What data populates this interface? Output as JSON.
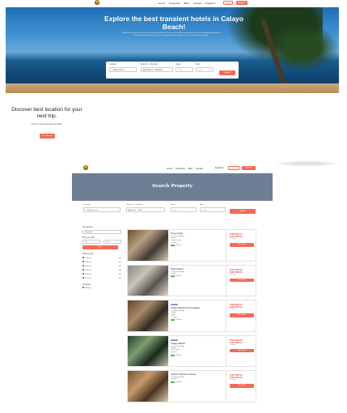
{
  "navbar": {
    "links": [
      "Home",
      "Properties",
      "Blog",
      "Contact"
    ],
    "language": "English",
    "login": "Login",
    "register": "Register"
  },
  "hero": {
    "title": "Explore the best transient hotels in Calayo Beach!",
    "subtitle": "Welcome to Guest, where your seaside escape begins! Discover your dream transient retreat with our handpicked collection of stunning beachside houses, all just a heartbeat away from the sun, sand, and waves adventure.",
    "search": {
      "location_label": "Location",
      "location_value": "Select One",
      "dates_label": "Check-In - Checkout",
      "dates_value": "Check-In - Checkout",
      "guests_label": "Guest",
      "guests_value": "1",
      "beds_label": "Beds",
      "beds_value": "1",
      "button": "Search"
    }
  },
  "discover": {
    "title": "Discover best location for your next trip.",
    "subtitle": "Find your perfect getaway destination",
    "button": "View all rooms"
  },
  "inner": {
    "navbar": {
      "links": [
        "Home",
        "Properties",
        "Blog",
        "Contact"
      ],
      "language": "English",
      "login": "Login",
      "register": "Register"
    },
    "banner_title": "Search Property",
    "search": {
      "location_label": "Location",
      "location_value": "Select One",
      "dates_label": "Check-In - Checkout",
      "dates_value": "1/1/23 - 1/2/23",
      "guests_label": "Guest",
      "guests_value": "1",
      "beds_label": "Bed",
      "beds_value": "1",
      "button": "Search"
    },
    "filters": {
      "sort_label": "Sort Results",
      "sort_value": "Popular",
      "price_label": "Price per night",
      "price_min": "Min",
      "price_max": "Max",
      "filter_button": "Filter",
      "property_label": "Property type",
      "types": [
        {
          "label": "1 Room",
          "count": "(12)"
        },
        {
          "label": "2 Room",
          "count": "(12)"
        },
        {
          "label": "3 Room",
          "count": "(12)"
        },
        {
          "label": "4 Room",
          "count": "(12)"
        },
        {
          "label": "5 Room",
          "count": "(12)"
        },
        {
          "label": "6 Room",
          "count": "(12)"
        }
      ],
      "amenities_label": "Amenities",
      "amenities": [
        {
          "label": "Parking"
        }
      ]
    },
    "listings": [
      {
        "badge": "",
        "title": "Tong Lodge",
        "location": "Calayo, Nasugbu",
        "features": [
          "Room",
          "Room Pooling",
          "1 Room"
        ],
        "rating": "4.5",
        "rating_text": "1 Review",
        "price_low": "PHP 2000.00",
        "price_high": "PHP 3500.00",
        "price_note": "Per night",
        "button": "View Details",
        "colors": [
          "#6b5236",
          "#b79f80",
          "#3f3a34",
          "#d9cab2"
        ]
      },
      {
        "badge": "",
        "title": "Tatia Sheraf",
        "location": "Calayo, Nasugbu",
        "features": [
          "Room"
        ],
        "rating": "4.5",
        "rating_text": "1 Review",
        "price_low": "PHP 2000.00",
        "price_high": "PHP 3500.00",
        "price_note": "Per night",
        "button": "View Details",
        "colors": [
          "#8a8a8a",
          "#c9c2b7",
          "#5a5450",
          "#dcd8d2"
        ]
      },
      {
        "badge": "Featured",
        "title": "Calayo Beach and Cottages",
        "location": "Calayo, Nasugbu",
        "features": [
          "Room",
          "Beach",
          "1 Room"
        ],
        "rating": "4.5",
        "rating_text": "1 Review",
        "price_low": "PHP 2000.00",
        "price_high": "PHP 3500.00",
        "price_note": "Per night",
        "button": "View Details",
        "colors": [
          "#5d4630",
          "#a98a66",
          "#2f2a25",
          "#c6b394"
        ]
      },
      {
        "badge": "Featured",
        "title": "Calayo Beach",
        "location": "Calayo, Nasugbu",
        "features": [
          "Room",
          "Pet Friendly",
          "1 Room"
        ],
        "rating": "4.5",
        "rating_text": "1 Review",
        "price_low": "PHP 2000.00",
        "price_high": "PHP 3500.00",
        "price_note": "Per night",
        "button": "View Details",
        "colors": [
          "#25402a",
          "#7e9c73",
          "#1a2a1b",
          "#b9c3a6"
        ]
      },
      {
        "badge": "",
        "title": "Andrea Transient House",
        "location": "Calayo, Nasugbu",
        "features": [
          "Parking"
        ],
        "rating": "4.5",
        "rating_text": "1 Review",
        "price_low": "PHP 2000.00",
        "price_high": "PHP 3500.00",
        "price_note": "Per night",
        "button": "View Details",
        "colors": [
          "#7a5434",
          "#c59b6c",
          "#4b3522",
          "#e0c9a8"
        ]
      }
    ]
  }
}
